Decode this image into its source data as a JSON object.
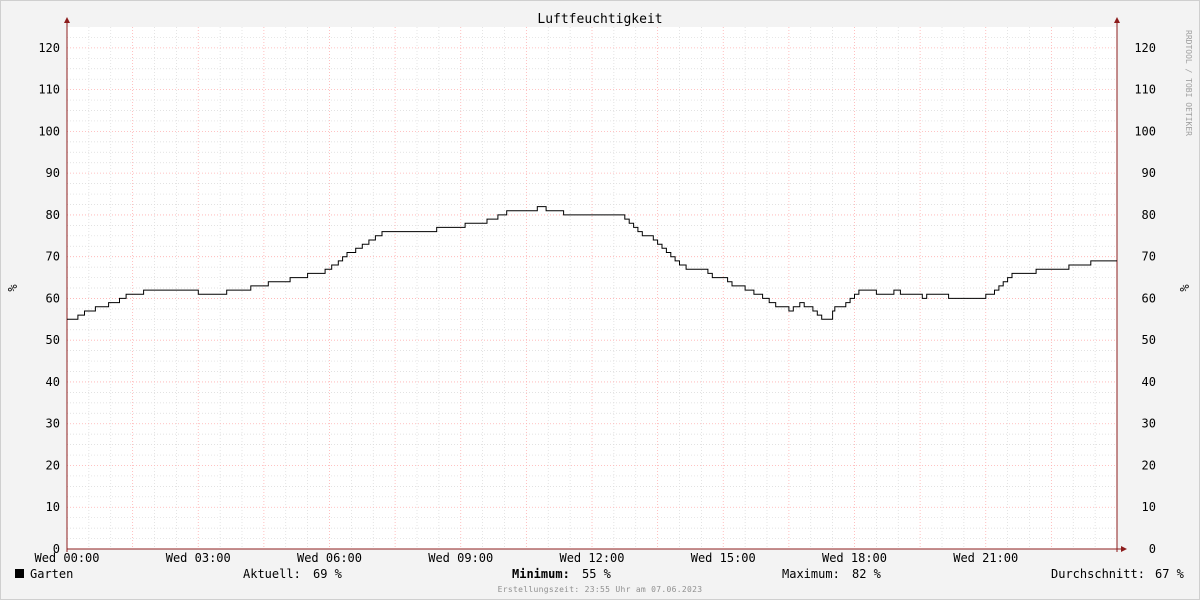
{
  "watermark": "RRDTOOL / TOBI OETIKER",
  "legend": {
    "series_label": "Garten",
    "current_label": "Aktuell:",
    "current_value": "69 %",
    "min_label": "Minimum:",
    "min_value": "55 %",
    "max_label": "Maximum:",
    "max_value": "82 %",
    "avg_label": "Durchschnitt:",
    "avg_value": "67 %"
  },
  "footer": "Erstellungszeit: 23:55 Uhr am 07.06.2023",
  "colors": {
    "line": "#000000",
    "major_grid": "#ffb0b0",
    "minor_grid": "#d9d9d9",
    "plot_bg": "#ffffff",
    "axis": "#8c1c1c"
  },
  "chart_data": {
    "type": "line",
    "title": "Luftfeuchtigkeit",
    "ylabel": "%",
    "xlabel": "",
    "ylim": [
      0,
      125
    ],
    "yticks": [
      0,
      10,
      20,
      30,
      40,
      50,
      60,
      70,
      80,
      90,
      100,
      110,
      120
    ],
    "xlim_hours": [
      0,
      24
    ],
    "xticks": [
      {
        "hour": 0,
        "label": "Wed 00:00"
      },
      {
        "hour": 3,
        "label": "Wed 03:00"
      },
      {
        "hour": 6,
        "label": "Wed 06:00"
      },
      {
        "hour": 9,
        "label": "Wed 09:00"
      },
      {
        "hour": 12,
        "label": "Wed 12:00"
      },
      {
        "hour": 15,
        "label": "Wed 15:00"
      },
      {
        "hour": 18,
        "label": "Wed 18:00"
      },
      {
        "hour": 21,
        "label": "Wed 21:00"
      }
    ],
    "grid": true,
    "step": true,
    "series": [
      {
        "name": "Garten",
        "points": [
          [
            0.0,
            55
          ],
          [
            0.25,
            56
          ],
          [
            0.4,
            57
          ],
          [
            0.65,
            58
          ],
          [
            0.95,
            59
          ],
          [
            1.2,
            60
          ],
          [
            1.35,
            61
          ],
          [
            1.75,
            62
          ],
          [
            3.0,
            61
          ],
          [
            3.65,
            62
          ],
          [
            4.2,
            63
          ],
          [
            4.6,
            64
          ],
          [
            5.1,
            65
          ],
          [
            5.5,
            66
          ],
          [
            5.9,
            67
          ],
          [
            6.05,
            68
          ],
          [
            6.2,
            69
          ],
          [
            6.3,
            70
          ],
          [
            6.4,
            71
          ],
          [
            6.6,
            72
          ],
          [
            6.75,
            73
          ],
          [
            6.9,
            74
          ],
          [
            7.05,
            75
          ],
          [
            7.2,
            76
          ],
          [
            8.45,
            77
          ],
          [
            9.1,
            78
          ],
          [
            9.6,
            79
          ],
          [
            9.85,
            80
          ],
          [
            10.05,
            81
          ],
          [
            10.75,
            82
          ],
          [
            10.95,
            81
          ],
          [
            11.35,
            80
          ],
          [
            12.75,
            79
          ],
          [
            12.85,
            78
          ],
          [
            12.95,
            77
          ],
          [
            13.05,
            76
          ],
          [
            13.15,
            75
          ],
          [
            13.4,
            74
          ],
          [
            13.5,
            73
          ],
          [
            13.6,
            72
          ],
          [
            13.7,
            71
          ],
          [
            13.8,
            70
          ],
          [
            13.9,
            69
          ],
          [
            14.0,
            68
          ],
          [
            14.15,
            67
          ],
          [
            14.65,
            66
          ],
          [
            14.75,
            65
          ],
          [
            15.1,
            64
          ],
          [
            15.2,
            63
          ],
          [
            15.5,
            62
          ],
          [
            15.7,
            61
          ],
          [
            15.9,
            60
          ],
          [
            16.05,
            59
          ],
          [
            16.2,
            58
          ],
          [
            16.5,
            57
          ],
          [
            16.6,
            58
          ],
          [
            16.75,
            59
          ],
          [
            16.85,
            58
          ],
          [
            17.05,
            57
          ],
          [
            17.15,
            56
          ],
          [
            17.25,
            55
          ],
          [
            17.5,
            57
          ],
          [
            17.55,
            58
          ],
          [
            17.8,
            59
          ],
          [
            17.9,
            60
          ],
          [
            18.0,
            61
          ],
          [
            18.1,
            62
          ],
          [
            18.5,
            61
          ],
          [
            18.9,
            62
          ],
          [
            19.05,
            61
          ],
          [
            19.55,
            60
          ],
          [
            19.65,
            61
          ],
          [
            20.15,
            60
          ],
          [
            21.0,
            61
          ],
          [
            21.2,
            62
          ],
          [
            21.3,
            63
          ],
          [
            21.4,
            64
          ],
          [
            21.5,
            65
          ],
          [
            21.6,
            66
          ],
          [
            22.15,
            67
          ],
          [
            22.9,
            68
          ],
          [
            23.4,
            69
          ],
          [
            24.0,
            69
          ]
        ]
      }
    ]
  }
}
